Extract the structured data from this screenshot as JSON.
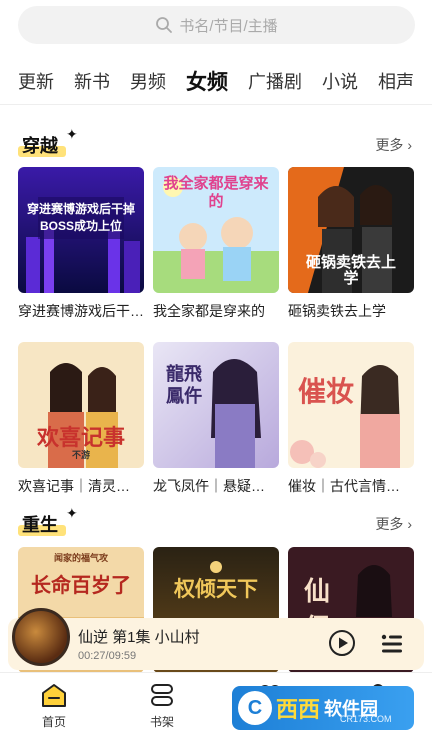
{
  "search": {
    "placeholder": "书名/节目/主播"
  },
  "tabs": [
    {
      "label": "更新"
    },
    {
      "label": "新书"
    },
    {
      "label": "男频"
    },
    {
      "label": "女频",
      "active": true
    },
    {
      "label": "广播剧"
    },
    {
      "label": "小说"
    },
    {
      "label": "相声"
    }
  ],
  "sections": [
    {
      "title": "穿越",
      "more": "更多 ›",
      "books": [
        {
          "title": "穿进赛博游戏后干掉BOSS成功上位",
          "cover_text": "穿进赛博游戏后干掉BOSS成功上位",
          "accent": "#6a3bd8"
        },
        {
          "title": "我全家都是穿来的",
          "cover_text": "我全家都是穿来的",
          "accent": "#8fcf6b"
        },
        {
          "title": "砸锅卖铁去上学",
          "cover_text": "砸锅卖铁去上学",
          "accent": "#e46a1b"
        }
      ]
    },
    {
      "title": "",
      "books": [
        {
          "title": "欢喜记事｜清灵…",
          "cover_text": "欢喜记事",
          "cover_sub": "不游",
          "accent": "#c8322d"
        },
        {
          "title": "龙飞凤仵｜悬疑…",
          "cover_text": "龍飛鳳仵",
          "accent": "#6b5aa8"
        },
        {
          "title": "催妆｜古代言情…",
          "cover_text": "催妆",
          "accent": "#d9534f"
        }
      ]
    },
    {
      "title": "重生",
      "more": "更多 ›",
      "books": [
        {
          "title": "",
          "cover_text": "长命百岁了",
          "cover_sub": "闻家的福气攻",
          "accent": "#b5281f"
        },
        {
          "title": "",
          "cover_text": "权倾天下",
          "accent": "#c29a3b"
        },
        {
          "title": "",
          "cover_text": "仙侶",
          "accent": "#8a2a3a"
        }
      ]
    }
  ],
  "player": {
    "title": "仙逆 第1集 小山村",
    "time": "00:27/09:59"
  },
  "bottom_nav": [
    {
      "label": "首页",
      "icon": "home-icon",
      "active": true
    },
    {
      "label": "书架",
      "icon": "bookshelf-icon"
    },
    {
      "label": "",
      "icon": "listen-icon"
    },
    {
      "label": "",
      "icon": "profile-icon"
    }
  ],
  "watermark": {
    "name": "西西",
    "sub": "软件园",
    "url": "CR173.COM"
  }
}
